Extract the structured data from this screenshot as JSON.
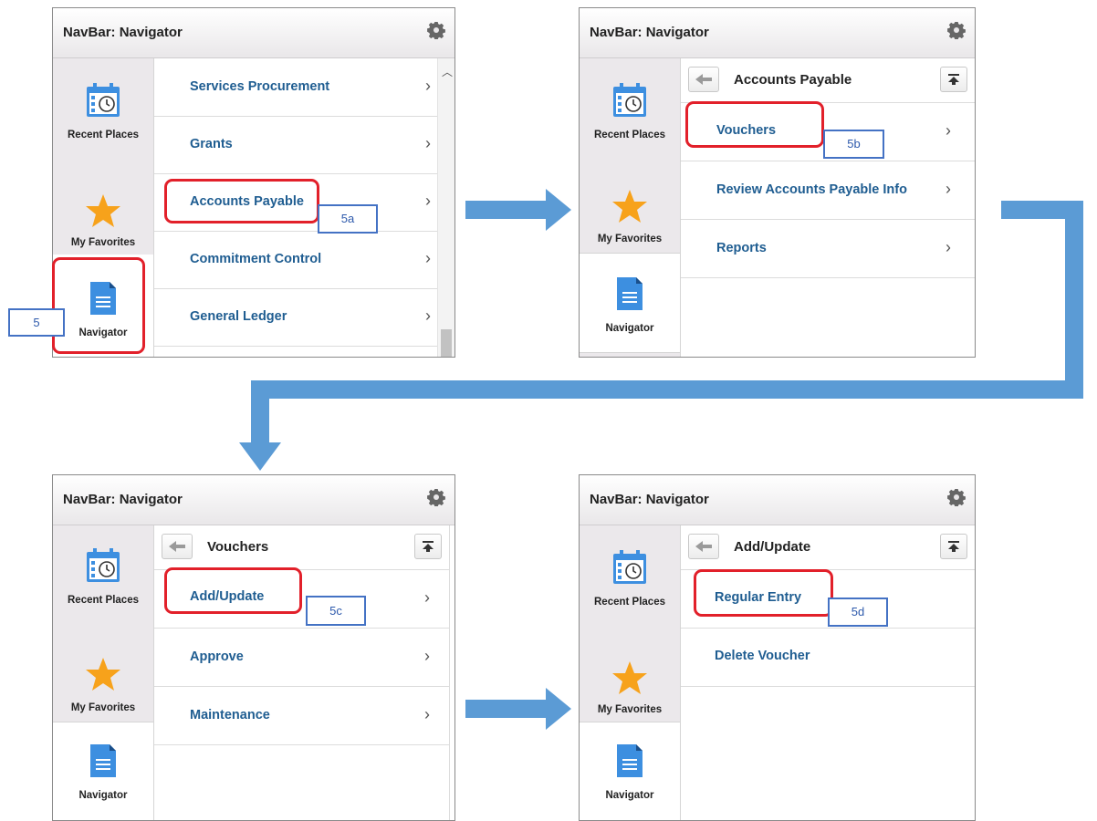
{
  "app_title": "NavBar: Navigator",
  "sidebar": {
    "recent": "Recent Places",
    "favorites": "My Favorites",
    "navigator": "Navigator"
  },
  "panel1": {
    "items": [
      {
        "label": "Services Procurement"
      },
      {
        "label": "Grants"
      },
      {
        "label": "Accounts Payable"
      },
      {
        "label": "Commitment Control"
      },
      {
        "label": "General Ledger"
      }
    ]
  },
  "panel2": {
    "header": "Accounts Payable",
    "items": [
      {
        "label": "Vouchers"
      },
      {
        "label": "Review Accounts Payable Info"
      },
      {
        "label": "Reports"
      }
    ]
  },
  "panel3": {
    "header": "Vouchers",
    "items": [
      {
        "label": "Add/Update"
      },
      {
        "label": "Approve"
      },
      {
        "label": "Maintenance"
      }
    ]
  },
  "panel4": {
    "header": "Add/Update",
    "items": [
      {
        "label": "Regular Entry"
      },
      {
        "label": "Delete Voucher"
      }
    ]
  },
  "chevron": "›",
  "callouts": {
    "c5": "5",
    "c5a": "5a",
    "c5b": "5b",
    "c5c": "5c",
    "c5d": "5d"
  },
  "colors": {
    "link": "#1f5d91",
    "highlight": "#e2202a",
    "callout_border": "#4472c4",
    "arrow": "#5b9bd5",
    "star": "#f7a21b",
    "doc_icon": "#3d8fe0"
  }
}
